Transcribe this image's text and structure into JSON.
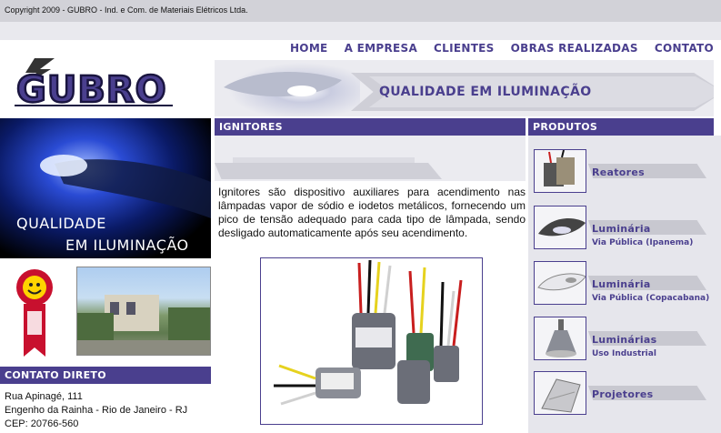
{
  "header": {
    "copyright": "Copyright 2009 - GUBRO - Ind. e Com. de Materiais Elétricos Ltda."
  },
  "nav": {
    "items": [
      {
        "label": "HOME"
      },
      {
        "label": "A EMPRESA"
      },
      {
        "label": "CLIENTES"
      },
      {
        "label": "OBRAS REALIZADAS"
      },
      {
        "label": "CONTATO"
      }
    ]
  },
  "logo": {
    "text": "GUBRO"
  },
  "banner": {
    "slogan": "QUALIDADE EM ILUMINAÇÃO"
  },
  "left_photo": {
    "line1": "QUALIDADE",
    "line2": "EM ILUMINAÇÃO"
  },
  "contato": {
    "title": "CONTATO DIRETO",
    "lines": [
      "Rua Apinagé, 111",
      "Engenho da Rainha - Rio de Janeiro - RJ",
      "CEP: 20766-560"
    ]
  },
  "main": {
    "title": "IGNITORES",
    "description": "Ignitores são dispositivo auxiliares para acendimento nas lâmpadas vapor de sódio e iodetos metálicos, fornecendo um pico de tensão adequado para cada tipo de lâmpada, sendo desligado automaticamente após seu acendimento."
  },
  "produtos": {
    "title": "PRODUTOS",
    "items": [
      {
        "name": "Reatores",
        "sub": ""
      },
      {
        "name": "Luminária",
        "sub": "Via Pública (Ipanema)"
      },
      {
        "name": "Luminária",
        "sub": "Via Pública (Copacabana)"
      },
      {
        "name": "Luminárias",
        "sub": "Uso Industrial"
      },
      {
        "name": "Projetores",
        "sub": ""
      }
    ]
  },
  "colors": {
    "brand": "#4a3f8e"
  }
}
